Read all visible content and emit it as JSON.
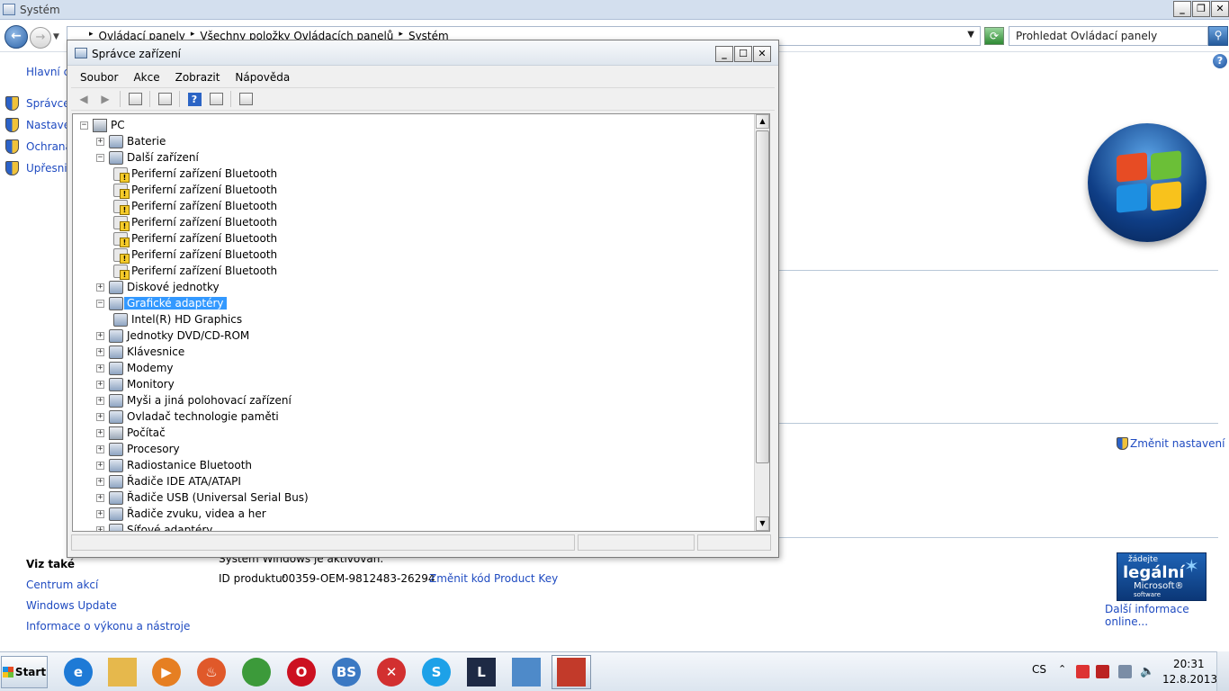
{
  "system_window": {
    "title": "Systém",
    "breadcrumb": [
      "Ovládací panely",
      "Všechny položky Ovládacích panelů",
      "Systém"
    ],
    "search_placeholder": "Prohledat Ovládací panely",
    "left_links": [
      "Hlavní c",
      "Správce",
      "Nastave",
      "Ochrana",
      "Upřesnit"
    ],
    "change_settings": "Změnit nastavení",
    "see_also_title": "Viz také",
    "see_also_links": [
      "Centrum akcí",
      "Windows Update",
      "Informace o výkonu a nástroje"
    ],
    "activation_text": "Systém Windows je aktivován.",
    "product_id_label": "ID produktu:",
    "product_id_value": "00359-OEM-9812483-26294",
    "change_product_key": "Změnit kód Product Key",
    "genuine_badge": {
      "line1": "žádejte",
      "line2": "legální",
      "line3": "Microsoft®",
      "line4": "software"
    },
    "more_info": "Další informace online..."
  },
  "device_manager": {
    "title": "Správce zařízení",
    "menu": [
      "Soubor",
      "Akce",
      "Zobrazit",
      "Nápověda"
    ],
    "tree": [
      {
        "label": "PC",
        "level": 0,
        "expander": "−",
        "icon": "computer-icon"
      },
      {
        "label": "Baterie",
        "level": 1,
        "expander": "+",
        "icon": "battery-icon"
      },
      {
        "label": "Další zařízení",
        "level": 1,
        "expander": "−",
        "icon": "unknown-device-icon"
      },
      {
        "label": "Periferní zařízení Bluetooth",
        "level": 2,
        "icon": "warning-device-icon"
      },
      {
        "label": "Periferní zařízení Bluetooth",
        "level": 2,
        "icon": "warning-device-icon"
      },
      {
        "label": "Periferní zařízení Bluetooth",
        "level": 2,
        "icon": "warning-device-icon"
      },
      {
        "label": "Periferní zařízení Bluetooth",
        "level": 2,
        "icon": "warning-device-icon"
      },
      {
        "label": "Periferní zařízení Bluetooth",
        "level": 2,
        "icon": "warning-device-icon"
      },
      {
        "label": "Periferní zařízení Bluetooth",
        "level": 2,
        "icon": "warning-device-icon"
      },
      {
        "label": "Periferní zařízení Bluetooth",
        "level": 2,
        "icon": "warning-device-icon"
      },
      {
        "label": "Diskové jednotky",
        "level": 1,
        "expander": "+",
        "icon": "disk-drive-icon"
      },
      {
        "label": "Grafické adaptéry",
        "level": 1,
        "expander": "−",
        "icon": "display-adapter-icon",
        "selected": true
      },
      {
        "label": "Intel(R) HD Graphics",
        "level": 2,
        "icon": "display-adapter-icon"
      },
      {
        "label": "Jednotky DVD/CD-ROM",
        "level": 1,
        "expander": "+",
        "icon": "dvd-drive-icon"
      },
      {
        "label": "Klávesnice",
        "level": 1,
        "expander": "+",
        "icon": "keyboard-icon"
      },
      {
        "label": "Modemy",
        "level": 1,
        "expander": "+",
        "icon": "modem-icon"
      },
      {
        "label": "Monitory",
        "level": 1,
        "expander": "+",
        "icon": "monitor-icon"
      },
      {
        "label": "Myši a jiná polohovací zařízení",
        "level": 1,
        "expander": "+",
        "icon": "mouse-icon"
      },
      {
        "label": "Ovladač technologie paměti",
        "level": 1,
        "expander": "+",
        "icon": "memory-controller-icon"
      },
      {
        "label": "Počítač",
        "level": 1,
        "expander": "+",
        "icon": "computer-icon"
      },
      {
        "label": "Procesory",
        "level": 1,
        "expander": "+",
        "icon": "processor-icon"
      },
      {
        "label": "Radiostanice Bluetooth",
        "level": 1,
        "expander": "+",
        "icon": "bluetooth-icon"
      },
      {
        "label": "Řadiče IDE ATA/ATAPI",
        "level": 1,
        "expander": "+",
        "icon": "ide-controller-icon"
      },
      {
        "label": "Řadiče USB (Universal Serial Bus)",
        "level": 1,
        "expander": "+",
        "icon": "usb-icon"
      },
      {
        "label": "Řadiče zvuku, videa a her",
        "level": 1,
        "expander": "+",
        "icon": "sound-icon"
      },
      {
        "label": "Síťové adaptéry",
        "level": 1,
        "expander": "+",
        "icon": "network-adapter-icon"
      }
    ]
  },
  "taskbar": {
    "start_label": "Start",
    "apps": [
      {
        "name": "internet-explorer-icon",
        "glyph": "e",
        "color": "#1e7ad6"
      },
      {
        "name": "file-explorer-icon",
        "glyph": "",
        "color": "#e6b84c"
      },
      {
        "name": "media-player-icon",
        "glyph": "▶",
        "color": "#e67f22"
      },
      {
        "name": "burner-icon",
        "glyph": "♨",
        "color": "#e0592a"
      },
      {
        "name": "chrome-icon",
        "glyph": "",
        "color": "#3c9a3a"
      },
      {
        "name": "opera-icon",
        "glyph": "O",
        "color": "#cc1020"
      },
      {
        "name": "bs-player-icon",
        "glyph": "BS",
        "color": "#3b79c3"
      },
      {
        "name": "close-app-icon",
        "glyph": "✕",
        "color": "#d23030"
      },
      {
        "name": "skype-icon",
        "glyph": "S",
        "color": "#1da1e8"
      },
      {
        "name": "league-of-legends-icon",
        "glyph": "L",
        "color": "#1e2a45"
      },
      {
        "name": "control-panel-icon",
        "glyph": "",
        "color": "#4e8ac9"
      },
      {
        "name": "toolbox-icon",
        "glyph": "",
        "color": "#c23a2a"
      }
    ],
    "language": "CS",
    "time": "20:31",
    "date": "12.8.2013"
  }
}
